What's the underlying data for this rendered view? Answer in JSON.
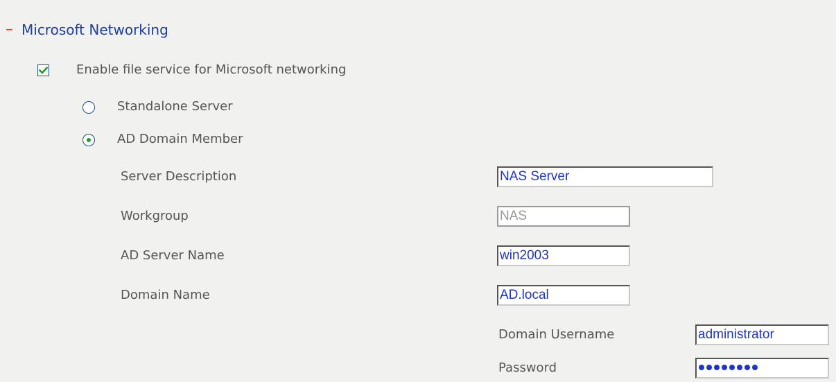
{
  "section": {
    "toggle": "–",
    "title": "Microsoft Networking"
  },
  "enable": {
    "label": "Enable file service for Microsoft networking",
    "checked": true
  },
  "mode": {
    "standalone_label": "Standalone Server",
    "ad_member_label": "AD Domain Member",
    "selected": "AD Domain Member"
  },
  "fields": {
    "server_description": {
      "label": "Server Description",
      "value": "NAS Server"
    },
    "workgroup": {
      "label": "Workgroup",
      "value": "NAS"
    },
    "ad_server_name": {
      "label": "AD Server Name",
      "value": "win2003"
    },
    "domain_name": {
      "label": "Domain Name",
      "value": "AD.local"
    },
    "domain_username": {
      "label": "Domain Username",
      "value": "administrator"
    },
    "password": {
      "label": "Password",
      "masked_length": 8
    }
  },
  "icons": {
    "checkbox_check": "check-icon",
    "collapse": "minus-icon"
  },
  "colors": {
    "title": "#1f3ea3",
    "toggle": "#e23b2a",
    "check": "#1f9d2a",
    "input_text": "#1f34c9",
    "panel_bg": "#f1f1ef"
  }
}
